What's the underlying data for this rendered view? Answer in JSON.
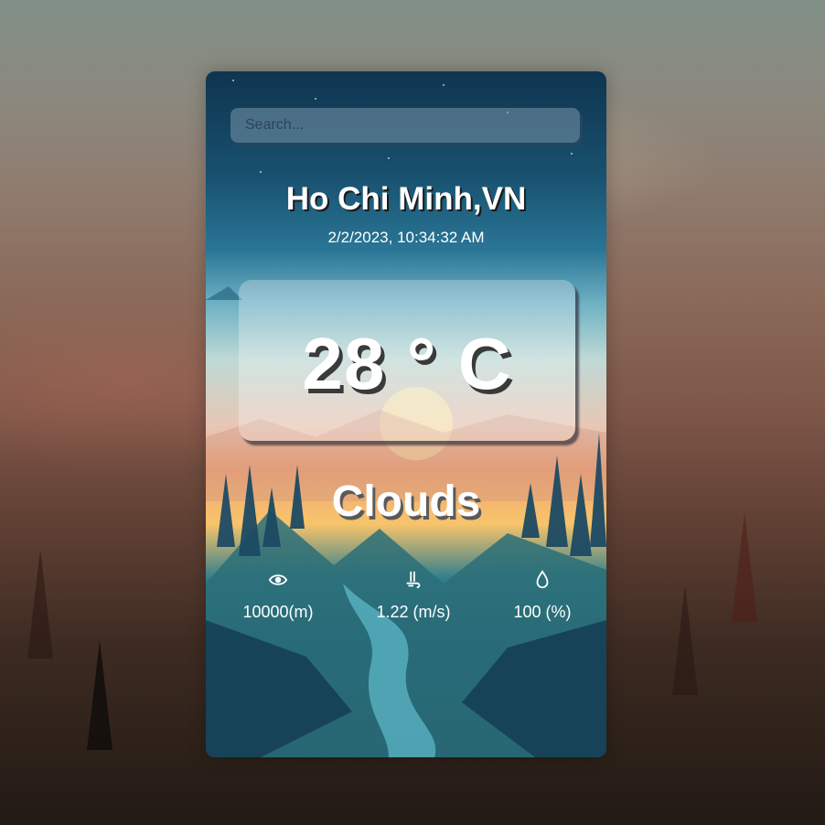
{
  "search": {
    "placeholder": "Search..."
  },
  "weather": {
    "city": "Ho Chi Minh,VN",
    "datetime": "2/2/2023, 10:34:32 AM",
    "temperature": "28 ° C",
    "condition": "Clouds"
  },
  "stats": {
    "visibility": {
      "icon": "eye-icon",
      "value": "10000(m)"
    },
    "wind": {
      "icon": "wind-icon",
      "value": "1.22 (m/s)"
    },
    "humidity": {
      "icon": "droplet-icon",
      "value": "100 (%)"
    }
  }
}
